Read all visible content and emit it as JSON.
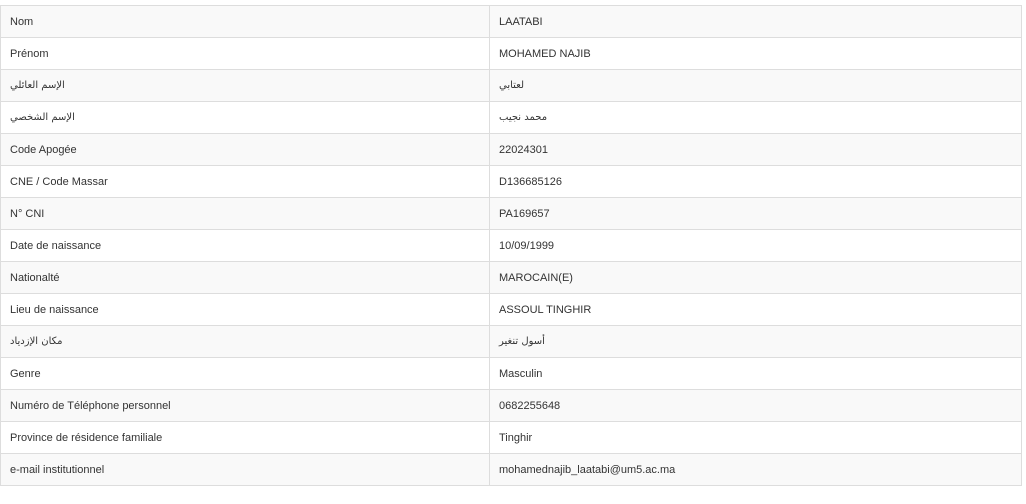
{
  "student_info": {
    "rows": [
      {
        "label": "Nom",
        "value": "LAATABI"
      },
      {
        "label": "Prénom",
        "value": "MOHAMED NAJIB"
      },
      {
        "label": "الإسم العائلي",
        "value": "لعتابي"
      },
      {
        "label": "الإسم الشخصي",
        "value": "محمد نجيب"
      },
      {
        "label": "Code Apogée",
        "value": "22024301"
      },
      {
        "label": "CNE / Code Massar",
        "value": "D136685126"
      },
      {
        "label": "N° CNI",
        "value": "PA169657"
      },
      {
        "label": "Date de naissance",
        "value": "10/09/1999"
      },
      {
        "label": "Nationalté",
        "value": "MAROCAIN(E)"
      },
      {
        "label": "Lieu de naissance",
        "value": "ASSOUL TINGHIR"
      },
      {
        "label": "مكان الإزدياد",
        "value": "أسول تنغير"
      },
      {
        "label": "Genre",
        "value": "Masculin"
      },
      {
        "label": "Numéro de Téléphone personnel",
        "value": "0682255648"
      },
      {
        "label": "Province de résidence familiale",
        "value": "Tinghir"
      },
      {
        "label": "e-mail institutionnel",
        "value": "mohamednajib_laatabi@um5.ac.ma"
      }
    ]
  }
}
